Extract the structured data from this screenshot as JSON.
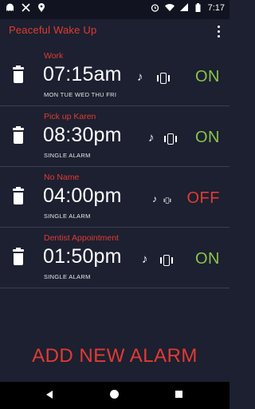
{
  "status_bar": {
    "time": "7:17",
    "left_icons": [
      "ghost-notification-icon",
      "tools-icon",
      "location-icon"
    ],
    "right_icons": [
      "alarm-clock-icon",
      "wifi-icon",
      "signal-icon",
      "battery-icon"
    ]
  },
  "app_bar": {
    "title": "Peaceful Wake Up",
    "menu_icon": "overflow-menu-icon",
    "accent_color": "#e23b32"
  },
  "alarms": [
    {
      "label": "Work",
      "time": "07:15am",
      "repeat": "MON TUE WED THU FRI",
      "status": "ON",
      "status_color": "#8bc34a",
      "music_icon": "music-note-icon",
      "vibrate_icon": "vibrate-icon"
    },
    {
      "label": "Pick up Karen",
      "time": "08:30pm",
      "repeat": "SINGLE ALARM",
      "status": "ON",
      "status_color": "#8bc34a",
      "music_icon": "music-note-icon",
      "vibrate_icon": "vibrate-icon"
    },
    {
      "label": "No Name",
      "time": "04:00pm",
      "repeat": "SINGLE ALARM",
      "status": "OFF",
      "status_color": "#e23b32",
      "music_icon": "music-note-icon",
      "vibrate_icon": "vibrate-icon"
    },
    {
      "label": "Dentist Appointment",
      "time": "01:50pm",
      "repeat": "SINGLE ALARM",
      "status": "ON",
      "status_color": "#8bc34a",
      "music_icon": "music-note-icon",
      "vibrate_icon": "vibrate-icon"
    }
  ],
  "add_button": {
    "label": "ADD NEW ALARM"
  },
  "nav_bar": {
    "back": "back-icon",
    "home": "home-icon",
    "recents": "recents-icon"
  }
}
